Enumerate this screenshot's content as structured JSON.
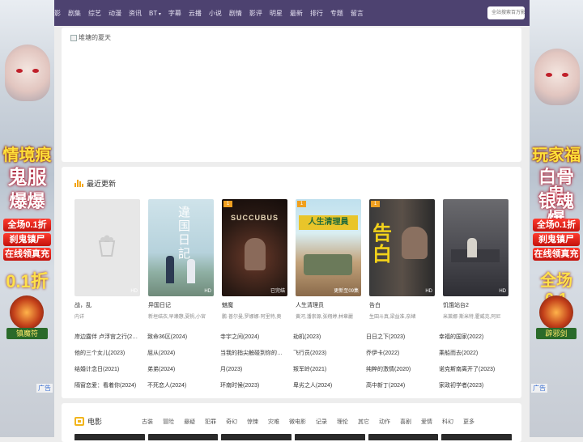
{
  "nav": {
    "items": [
      "影",
      "剧集",
      "综艺",
      "动漫",
      "资讯",
      "BT",
      "字幕",
      "云播",
      "小说",
      "剧情",
      "影评",
      "明星",
      "最新",
      "排行",
      "专题",
      "留言"
    ],
    "search_placeholder": "全站搜索百万影片"
  },
  "banner": {
    "image_alt": "堆塘的夏天"
  },
  "recent": {
    "title": "最近更新",
    "cards": [
      {
        "title": "战，乱",
        "sub": "内详",
        "badge": "HD",
        "corner": ""
      },
      {
        "title": "异国日记",
        "sub": "新垣结衣,早濑憩,夏帆,小宮",
        "badge": "HD",
        "corner": ""
      },
      {
        "title": "魅魔",
        "sub": "鹏·普尔曼,罗娜娜·阿里特,奥",
        "badge": "已完结",
        "corner": "1"
      },
      {
        "title": "人生清理员",
        "sub": "黄河,潘崇源,张翔婷,林章麗",
        "badge": "更新至09集",
        "corner": "1"
      },
      {
        "title": "告白",
        "sub": "生田斗真,梁益准,奈緒",
        "badge": "HD",
        "corner": "1"
      },
      {
        "title": "饥饿站台2",
        "sub": "米莱娜·斯米特,霍威克,阿尼",
        "badge": "HD",
        "corner": ""
      }
    ],
    "list": [
      [
        "岸边露伴 卢浮宫之行(2…",
        "致命36区(2024)",
        "寺宇之间(2024)",
        "劫机(2023)",
        "日日之下(2023)",
        "幸福的国家(2022)"
      ],
      [
        "他的三个女儿(2023)",
        "屈从(2024)",
        "当我的指尖触碰到你的…",
        "飞行员(2023)",
        "乔伊卡(2022)",
        "乘船而去(2022)"
      ],
      [
        "结婚计念日(2021)",
        "弟弟(2024)",
        "月(2023)",
        "叛军岭(2021)",
        "纯粹的激情(2020)",
        "诺克斯南离开了(2023)"
      ],
      [
        "隔窗恋爱：看着你(2024)",
        "不死恋人(2024)",
        "环南时候(2023)",
        "卑劣之人(2024)",
        "高中新丁(2024)",
        "家政初学者(2023)"
      ]
    ]
  },
  "movies": {
    "title": "电影",
    "genres": [
      "古装",
      "冒险",
      "悬疑",
      "犯罪",
      "奇幻",
      "惊悚",
      "灾难",
      "微电影",
      "记录",
      "理伦",
      "其它",
      "动作",
      "喜剧",
      "爱情",
      "科幻",
      "更多"
    ]
  },
  "ad_left": {
    "lines": [
      "情境痕",
      "鬼服",
      "爆爆"
    ],
    "promo": "全场0.1折",
    "town": "刹鬼镇尸",
    "recharge": "在线领真充",
    "discount": "0.1折",
    "item_name": "镇魔符",
    "mark": "广告"
  },
  "ad_right": {
    "lines": [
      "玩家福",
      "白骨鬼",
      "银魂爆"
    ],
    "promo": "全场0.1折",
    "town": "刹鬼镇尸",
    "recharge": "在线领真充",
    "discount": "全场0.1",
    "item_name": "辟邪剑",
    "mark": "广告"
  },
  "colors": {
    "nav_bg": "#4d4270",
    "accent": "#f2a516"
  }
}
